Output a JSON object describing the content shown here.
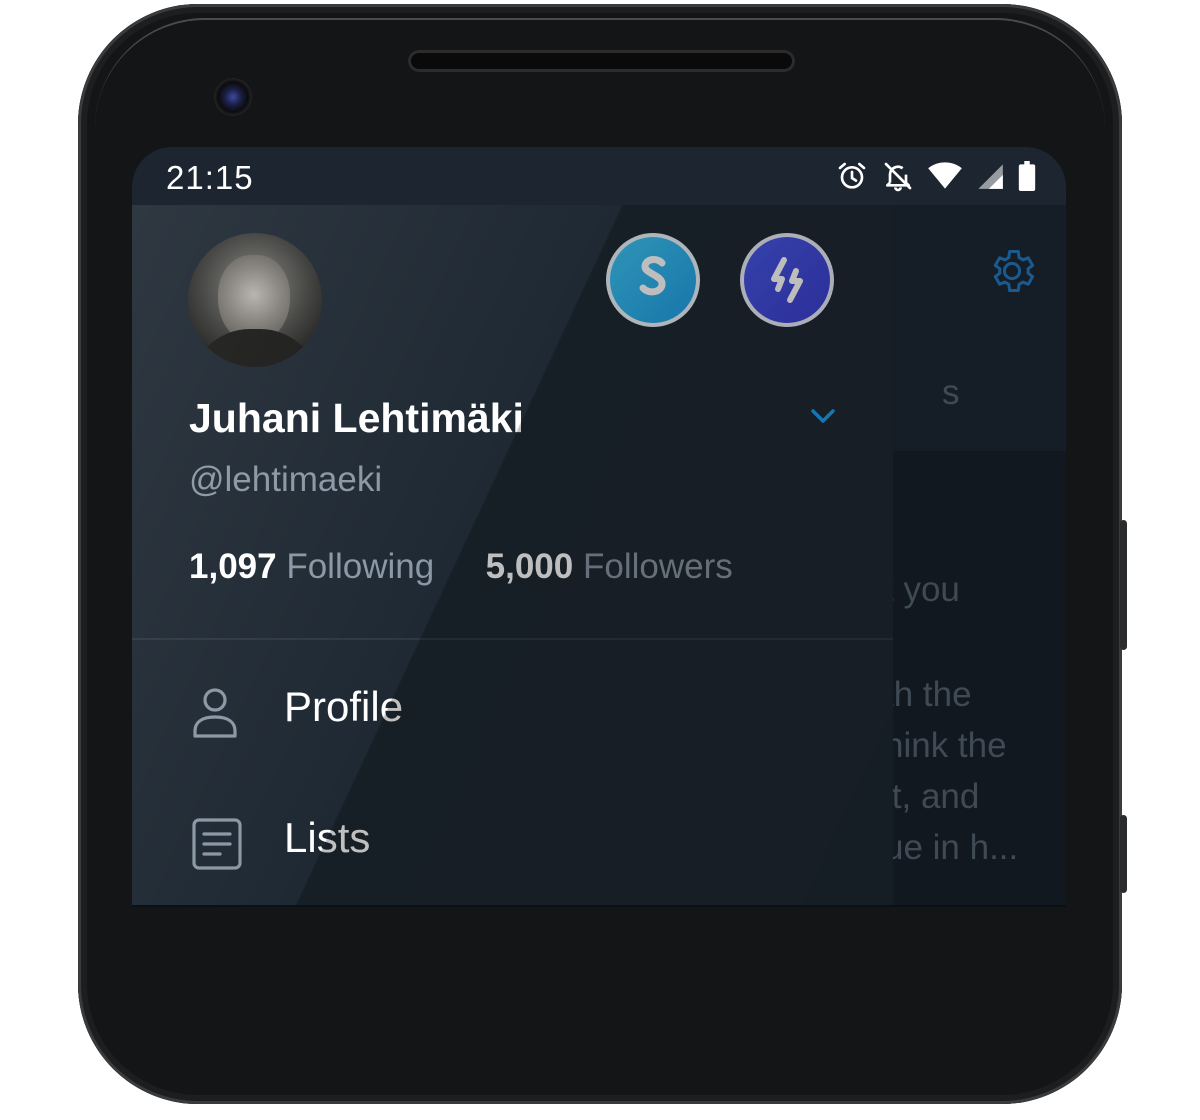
{
  "statusbar": {
    "time": "21:15",
    "icons": [
      "alarm-icon",
      "notifications-off-icon",
      "wifi-icon",
      "signal-icon",
      "battery-icon"
    ]
  },
  "drawer": {
    "user": {
      "name": "Juhani Lehtimäki",
      "handle": "@lehtimaeki"
    },
    "accounts": [
      "account-switch-1",
      "account-switch-2"
    ],
    "stats": {
      "following_count": "1,097",
      "following_label": "Following",
      "followers_count": "5,000",
      "followers_label": "Followers"
    },
    "menu": [
      {
        "label": "Profile",
        "icon": "person-icon"
      },
      {
        "label": "Lists",
        "icon": "list-icon"
      }
    ]
  },
  "background_app": {
    "fragments": [
      "s",
      "t you",
      "th the",
      "hink the",
      "it, and",
      "ue in h..."
    ]
  },
  "colors": {
    "drawer_bg": "#1f2933",
    "accent": "#1da1f2",
    "muted_text": "#8a97a4"
  }
}
